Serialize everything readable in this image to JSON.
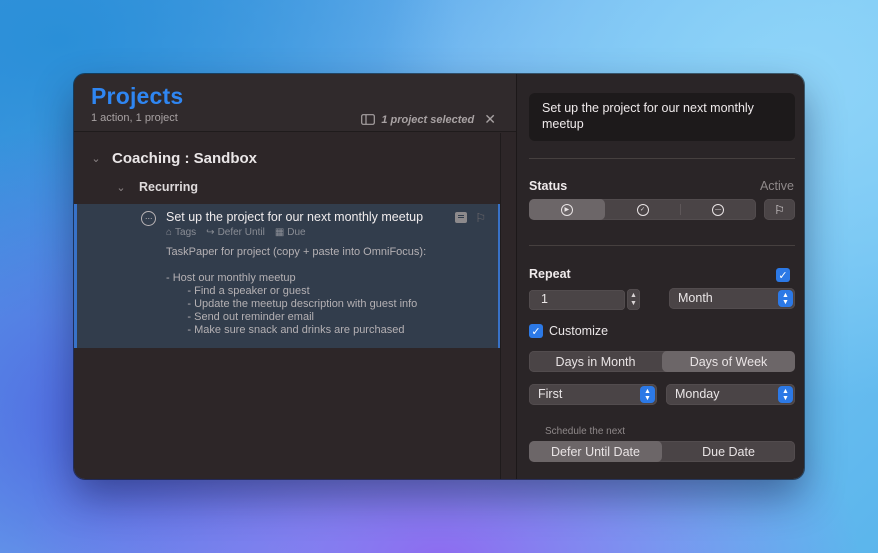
{
  "header": {
    "title": "Projects",
    "subtitle": "1 action, 1 project",
    "selection": "1 project selected"
  },
  "outline": {
    "folder": "Coaching : Sandbox",
    "project": "Recurring",
    "task": {
      "title": "Set up the project for our next monthly meetup",
      "tags_label": "Tags",
      "defer_label": "Defer Until",
      "due_label": "Due",
      "note": "TaskPaper for project (copy + paste into OmniFocus):\n\n- Host our monthly meetup\n       - Find a speaker or guest\n       - Update the meetup description with guest info\n       - Send out reminder email\n       - Make sure snack and drinks are purchased"
    }
  },
  "inspector": {
    "name": "Set up the project for our next monthly meetup",
    "status_label": "Status",
    "status_value": "Active",
    "repeat_label": "Repeat",
    "repeat_checked": true,
    "interval": "1",
    "unit": "Month",
    "customize_label": "Customize",
    "customize_checked": true,
    "mode_tabs": [
      "Days in Month",
      "Days of Week"
    ],
    "ordinal": "First",
    "weekday": "Monday",
    "schedule_label": "Schedule the next",
    "schedule_tabs": [
      "Defer Until Date",
      "Due Date"
    ]
  },
  "colors": {
    "accent": "#2f86f2",
    "selection_row": "#323d4c",
    "checkbox": "#2c79e6"
  }
}
